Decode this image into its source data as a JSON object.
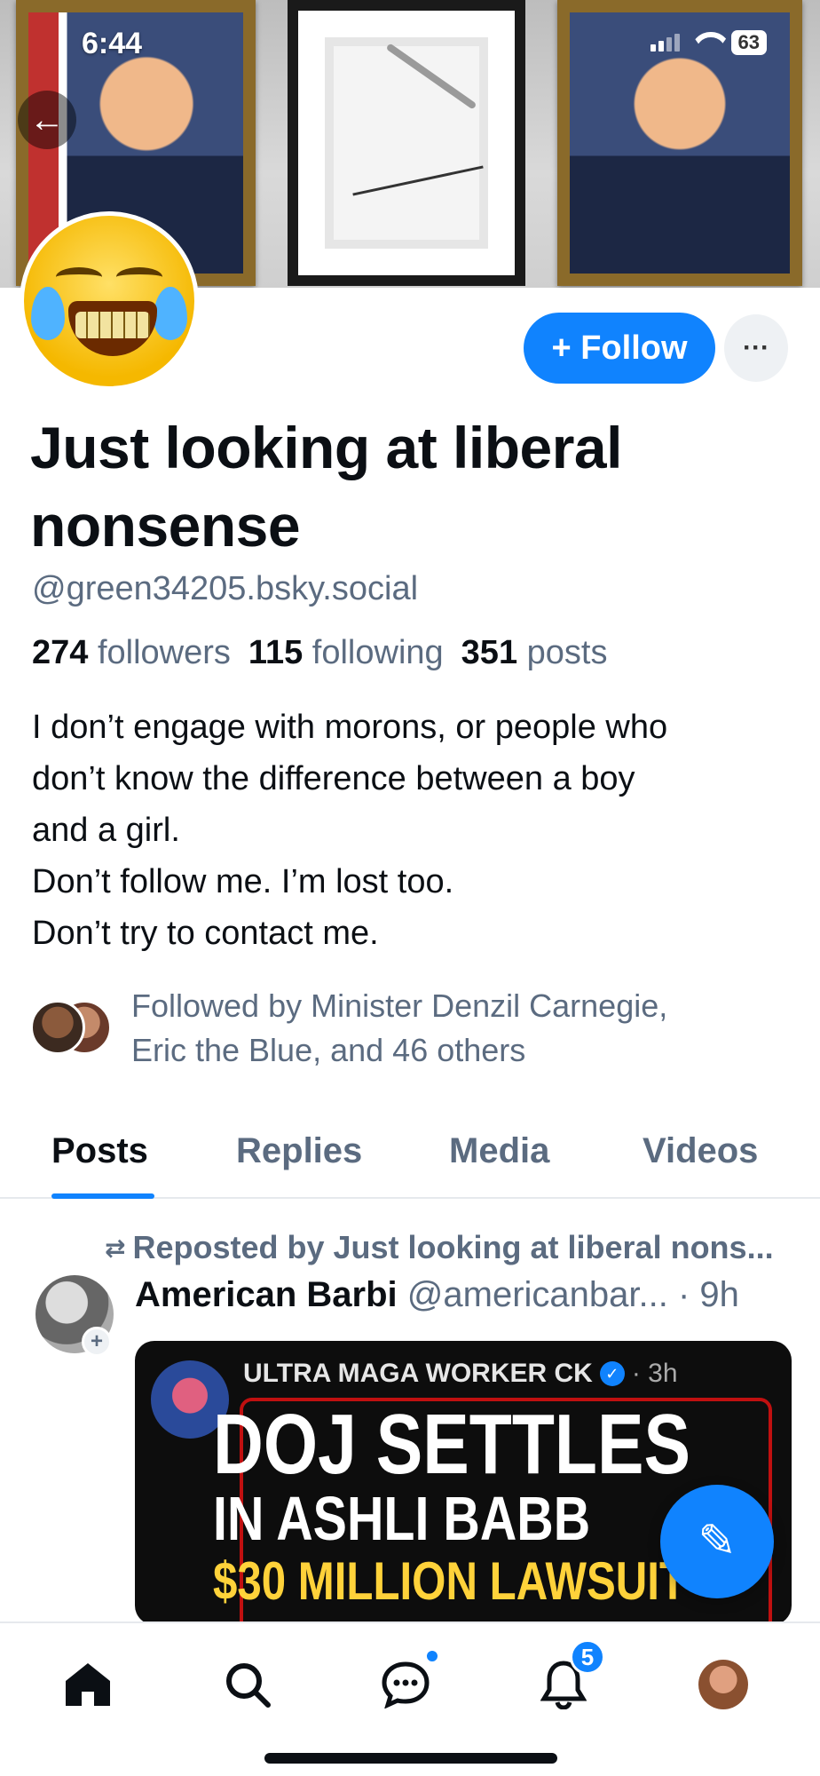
{
  "status_bar": {
    "time": "6:44",
    "battery": "63"
  },
  "profile": {
    "display_name": "Just looking at liberal nonsense",
    "handle": "@green34205.bsky.social",
    "followers_count": "274",
    "followers_label": "followers",
    "following_count": "115",
    "following_label": "following",
    "posts_count": "351",
    "posts_label": "posts",
    "bio_lines": [
      "I don’t engage with morons, or people who",
      "don’t know the difference between a boy",
      "and a girl.",
      "Don’t follow me. I’m lost too.",
      "Don’t try to contact me."
    ],
    "followed_by_line1": "Followed by Minister Denzil Carnegie,",
    "followed_by_line2": "Eric the Blue, and 46 others"
  },
  "actions": {
    "follow_label": "+ Follow",
    "more_label": "···"
  },
  "tabs": [
    {
      "label": "Posts",
      "active": true
    },
    {
      "label": "Replies",
      "active": false
    },
    {
      "label": "Media",
      "active": false
    },
    {
      "label": "Videos",
      "active": false
    }
  ],
  "post": {
    "repost_text": "Reposted by Just looking at liberal nons...",
    "author": "American Barbi",
    "meta": "@americanbar... · 9h",
    "embed": {
      "author": "ULTRA MAGA WORKER CK",
      "time": "· 3h",
      "headline1": "DOJ SETTLES",
      "headline2": "IN ASHLI BABB",
      "headline3": "$30 MILLION LAWSUIT"
    }
  },
  "bottom_nav": {
    "items": [
      "home-icon",
      "search-icon",
      "chat-icon",
      "bell-icon",
      "profile-avatar"
    ],
    "notification_count": "5"
  },
  "colors": {
    "accent": "#1083fe",
    "muted": "#5b6b80",
    "text": "#0b0f14"
  }
}
